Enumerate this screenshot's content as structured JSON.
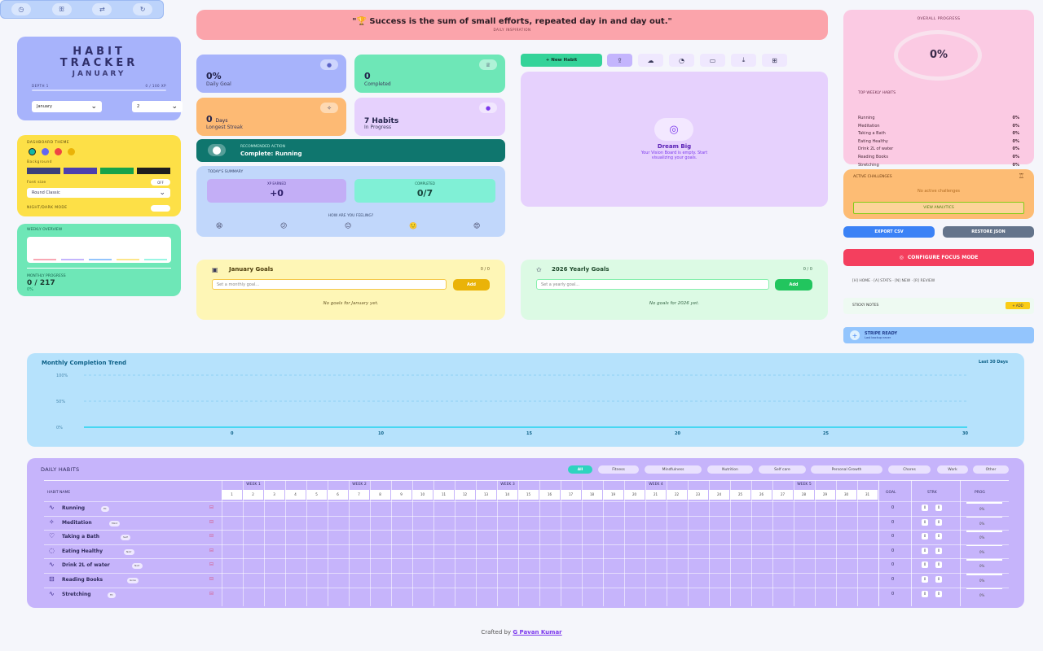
{
  "iconbar": {
    "icons": [
      "clock-icon",
      "people-icon",
      "arrows-icon",
      "refresh-icon"
    ]
  },
  "title": {
    "line1": "HABIT",
    "line2": "TRACKER",
    "month": "JANUARY",
    "left_label": "DEPTH 1",
    "right_label": "0 / 100 XP",
    "month_select": "January",
    "year_select": "2"
  },
  "theme": {
    "caption": "DASHBOARD THEME",
    "background_label": "Background",
    "font_label": "Font size",
    "font_toggle": "OFF",
    "font_select": "Round Classic",
    "night_label": "NIGHT/DARK MODE",
    "dots": [
      "#14b8a6",
      "#6366f1",
      "#ef4444",
      "#eab308"
    ],
    "swatches": [
      "#3b3f7a",
      "#4c3fae",
      "#16a34a",
      "#1e1e1e"
    ]
  },
  "weekly": {
    "caption": "WEEKLY OVERVIEW",
    "progress_label": "MONTHLY PROGRESS",
    "progress_value": "0 / 217",
    "progress_pct": "0%"
  },
  "quote": {
    "text": "\"🏆 Success is the sum of small efforts, repeated day in and day out.\"",
    "subtitle": "DAILY INSPIRATION"
  },
  "stats": [
    {
      "value": "0%",
      "label": "Daily Goal",
      "bg": "#a7b3fb",
      "badge": "●"
    },
    {
      "value": "0",
      "label": "Completed",
      "bg": "#6ee7b7",
      "badge": "♕"
    },
    {
      "value": "0",
      "value_suffix": "Days",
      "label": "Longest Streak",
      "bg": "#fdba74",
      "badge": "✧"
    },
    {
      "value": "7 Habits",
      "label": "In Progress",
      "bg": "#e6d1fd",
      "badge": "●"
    }
  ],
  "recommended": {
    "caption": "RECOMMENDED ACTION",
    "text": "Complete: Running"
  },
  "summary": {
    "caption": "TODAY'S SUMMARY",
    "xp_label": "XP EARNED",
    "xp_value": "+0",
    "comp_label": "COMPLETED",
    "comp_value": "0/7",
    "mood_label": "HOW ARE YOU FEELING?",
    "moods": [
      "😫",
      "😕",
      "😐",
      "🙂",
      "😍"
    ]
  },
  "toolbar": {
    "new_habit": "+ New Habit",
    "icons": [
      "upload-icon",
      "cloud-icon",
      "timer-icon",
      "archive-icon",
      "download-icon",
      "book-icon"
    ]
  },
  "vision": {
    "title": "Dream Big",
    "line1": "Your Vision Board is empty. Start",
    "line2": "visualizing your goals."
  },
  "jan_goals": {
    "title": "January Goals",
    "count": "0 / 0",
    "placeholder": "Set a monthly goal...",
    "add": "Add",
    "empty": "No goals for January yet."
  },
  "year_goals": {
    "title": "2026 Yearly Goals",
    "count": "0 / 0",
    "placeholder": "Set a yearly goal...",
    "add": "Add",
    "empty": "No goals for 2026 yet."
  },
  "overall": {
    "caption": "OVERALL PROGRESS",
    "percent": "0%",
    "top_caption": "TOP WEEKLY HABITS",
    "items": [
      {
        "name": "Running",
        "pct": "0%"
      },
      {
        "name": "Meditation",
        "pct": "0%"
      },
      {
        "name": "Taking a Bath",
        "pct": "0%"
      },
      {
        "name": "Eating Healthy",
        "pct": "0%"
      },
      {
        "name": "Drink 2L of water",
        "pct": "0%"
      },
      {
        "name": "Reading Books",
        "pct": "0%"
      },
      {
        "name": "Stretching",
        "pct": "0%"
      }
    ]
  },
  "challenge": {
    "caption": "ACTIVE CHALLENGES",
    "empty": "No active challenges",
    "button": "VIEW ANALYTICS"
  },
  "export": {
    "csv": "EXPORT CSV",
    "json": "RESTORE JSON"
  },
  "focus": {
    "button": "CONFIGURE FOCUS MODE",
    "shortcuts": "[H] HOME · [A] STATS · [N] NEW · [R] REVIEW",
    "sticky_label": "STICKY NOTES",
    "sticky_add": "+ ADD",
    "stripe": "STRIPE READY",
    "stripe_sub": "Last backup never"
  },
  "trend": {
    "title": "Monthly Completion Trend",
    "range": "Last 30 Days"
  },
  "chart_data": {
    "type": "line",
    "x": [
      0,
      5,
      10,
      15,
      20,
      25,
      30
    ],
    "x_ticks": [
      "0",
      "10",
      "15",
      "20",
      "25",
      "30"
    ],
    "series": [
      {
        "values": [
          0,
          0,
          0,
          0,
          0,
          0,
          0
        ]
      }
    ],
    "ylabels": [
      "100%",
      "50%",
      "0%"
    ],
    "ylim": [
      0,
      100
    ]
  },
  "daily": {
    "title": "DAILY HABITS",
    "filters": [
      "All",
      "Fitness",
      "Mindfulness",
      "Nutrition",
      "Self care",
      "Personal Growth",
      "Chores",
      "Work",
      "Other"
    ],
    "habit_col": "HABIT NAME",
    "weeks": [
      "WEEK 1",
      "WEEK 2",
      "WEEK 3",
      "WEEK 4",
      "WEEK 5"
    ],
    "goal_col": "GOAL",
    "streak_col": "STRK",
    "prog_col": "PROG",
    "habits": [
      {
        "name": "Running",
        "tag": "Fit",
        "icon": "pulse-icon"
      },
      {
        "name": "Meditation",
        "tag": "Mind",
        "icon": "sparkle-icon"
      },
      {
        "name": "Taking a Bath",
        "tag": "Self",
        "icon": "heart-icon"
      },
      {
        "name": "Eating Healthy",
        "tag": "Nutr",
        "icon": "apple-icon"
      },
      {
        "name": "Drink 2L of water",
        "tag": "Nutr",
        "icon": "pulse-icon"
      },
      {
        "name": "Reading Books",
        "tag": "Grow",
        "icon": "book-icon"
      },
      {
        "name": "Stretching",
        "tag": "Fit",
        "icon": "pulse-icon"
      }
    ],
    "goal_value": "0",
    "streak_values": [
      "0",
      "0"
    ],
    "prog_value": "0%"
  },
  "footer": {
    "prefix": "Crafted by ",
    "author": "G Pavan Kumar"
  }
}
